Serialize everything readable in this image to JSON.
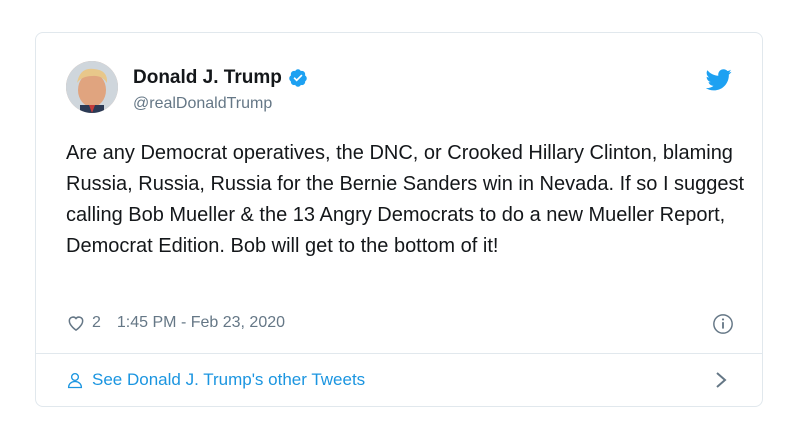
{
  "tweet": {
    "author_name": "Donald J. Trump",
    "handle": "@realDonaldTrump",
    "text": "Are any Democrat operatives, the DNC, or Crooked Hillary Clinton, blaming Russia, Russia, Russia for the Bernie Sanders win in Nevada. If so I suggest calling Bob Mueller & the 13 Angry Democrats to do a new Mueller Report, Democrat Edition. Bob will get to the bottom of it!",
    "likes": "2",
    "timestamp": "1:45 PM - Feb 23, 2020"
  },
  "footer": {
    "link_label": "See Donald J. Trump's other Tweets"
  },
  "colors": {
    "brand": "#1da1f2",
    "link": "#1b95e0",
    "muted": "#657786",
    "border": "#e1e8ed"
  },
  "icons": [
    "verified-badge-icon",
    "twitter-bird-icon",
    "heart-icon",
    "info-icon",
    "person-icon",
    "chevron-right-icon"
  ]
}
